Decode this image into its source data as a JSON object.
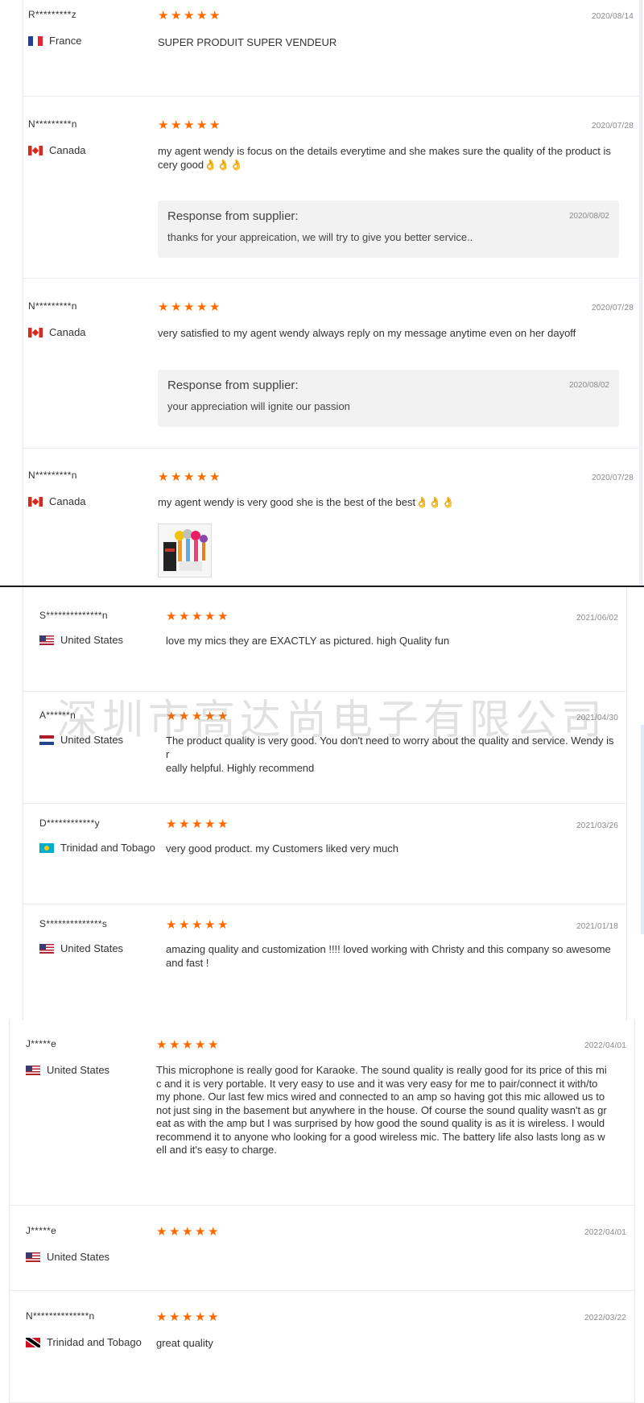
{
  "watermark": "深圳市高达尚电子有限公司",
  "accent_color": "#ff6a00",
  "panel_a": {
    "reviews": [
      {
        "user": "R*********z",
        "country": "France",
        "flag": "france-flag",
        "rating": 5,
        "date": "2020/08/14",
        "text": "SUPER PRODUIT SUPER VENDEUR"
      },
      {
        "user": "N*********n",
        "country": "Canada",
        "flag": "canada-flag",
        "rating": 5,
        "date": "2020/07/28",
        "text": "my agent wendy is focus on the details everytime and she makes sure the quality of the product is cery good👌👌👌",
        "response": {
          "title": "Response from supplier:",
          "date": "2020/08/02",
          "text": "thanks for your appreication, we will try to give you better service.."
        }
      },
      {
        "user": "N*********n",
        "country": "Canada",
        "flag": "canada-flag",
        "rating": 5,
        "date": "2020/07/28",
        "text": "very satisfied to my agent wendy always reply on my message anytime even on her dayoff",
        "response": {
          "title": "Response from supplier:",
          "date": "2020/08/02",
          "text": "your appreciation will ignite our passion"
        }
      },
      {
        "user": "N*********n",
        "country": "Canada",
        "flag": "canada-flag",
        "rating": 5,
        "date": "2020/07/28",
        "text": "my agent wendy is very good she is the best of the best👌👌👌",
        "photo": "microphones-photo"
      }
    ]
  },
  "panel_b": {
    "reviews": [
      {
        "user": "S**************n",
        "country": "United States",
        "flag": "us-flag",
        "rating": 5,
        "date": "2021/06/02",
        "text": "love my mics they are EXACTLY as pictured. high Quality fun"
      },
      {
        "user": "A******n",
        "country": "United States",
        "flag": "netherlands-flag",
        "rating": 5,
        "date": "2021/04/30",
        "text": "The product quality is very good. You don't need to worry about the quality and service. Wendy is r\neally helpful. Highly recommend"
      },
      {
        "user": "D************y",
        "country": "Trinidad and Tobago",
        "flag": "kazakhstan-flag",
        "rating": 5,
        "date": "2021/03/26",
        "text": "very good product. my Customers liked very much"
      },
      {
        "user": "S**************s",
        "country": "United States",
        "flag": "us-flag",
        "rating": 5,
        "date": "2021/01/18",
        "text": "amazing quality and customization !!!! loved working with Christy and this company so awesome\nand fast !"
      }
    ]
  },
  "panel_c": {
    "reviews": [
      {
        "user": "J*****e",
        "country": "United States",
        "flag": "us-flag",
        "rating": 5,
        "date": "2022/04/01",
        "text": "This microphone is really good for Karaoke. The sound quality is really good for its price of this mi\nc and it is very portable. It very easy to use and it was very easy for me to pair/connect it with/to\nmy phone. Our last few mics wired and connected to an amp so having got this mic allowed us to\nnot just sing in the basement but anywhere in the house. Of course the sound quality wasn't as gr\neat as with the amp but I was surprised by how good the sound quality is as it is wireless. I would\nrecommend it to anyone who looking for a good wireless mic. The battery life also lasts long as w\nell and it's easy to charge."
      },
      {
        "user": "J*****e",
        "country": "United States",
        "flag": "us-flag",
        "rating": 5,
        "date": "2022/04/01",
        "text": ""
      },
      {
        "user": "N**************n",
        "country": "Trinidad and Tobago",
        "flag": "trinidad-flag",
        "rating": 5,
        "date": "2022/03/22",
        "text": "great quality"
      }
    ]
  }
}
